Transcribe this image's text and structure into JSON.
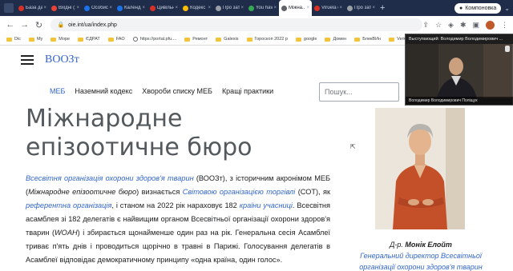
{
  "tabs": [
    {
      "label": "Базa даних ...",
      "color": "#d93025"
    },
    {
      "label": "Вхідні (1) – ...",
      "color": "#ea4335"
    },
    {
      "label": "Особиста ...",
      "color": "#1a73e8"
    },
    {
      "label": "Календар Go...",
      "color": "#1a73e8"
    },
    {
      "label": "Цивільний ...",
      "color": "#d93025"
    },
    {
      "label": "Кодекс атлан...",
      "color": "#fbbc04"
    },
    {
      "label": "Про затвер...",
      "color": "#9aa0a6"
    },
    {
      "label": "You have leg...",
      "color": "#34a853"
    },
    {
      "label": "Міжна...",
      "color": "#5f6368",
      "active": true
    },
    {
      "label": "Viruela ovin...",
      "color": "#d93025"
    },
    {
      "label": "Про затвер...",
      "color": "#9aa0a6"
    }
  ],
  "new_tab": "+",
  "profile_button": "Компоновка",
  "url": "oie.int/ua/index.php",
  "bookmarks": [
    "Dic",
    "My",
    "Море",
    "ЄДРАТ",
    "FAO",
    "https://portal.pfu....",
    "Ремонт",
    "Galexis",
    "Гороскоп 2022 р",
    "google",
    "Домен",
    "БлекВИн",
    "VerkPanel"
  ],
  "site": {
    "wordmark": "ВООЗт",
    "nav": [
      "МЕБ",
      "Наземний кодекс",
      "Хвороби списку МЕБ",
      "Кращі практики"
    ],
    "search_placeholder": "Пошук...",
    "title": "Міжнародне епізоотичне бюро",
    "caption_prefix": "Д-р. ",
    "caption_name": "Монік Елойт",
    "caption_role": "Генеральний директор Всесвітньої організації охорони здоров'я тварин"
  },
  "body": {
    "p1": "Всесвітня організація охорони здоров'я тварин",
    "p2": " (ВООЗт), з історичним акронімом МЕБ (",
    "p3": "Міжнародне епізоотичне бюро",
    "p4": ") визнається ",
    "p5": "Світовою організацією торгівлі",
    "p6": " (СОТ), як ",
    "p7": "референтна організація",
    "p8": ", і станом на 2022 рік нараховує 182 ",
    "p9": "країни учасниці",
    "p10": ". Всесвітня асамблея зі 182 делегатів є найвищим органом Всесвітньої організації охорони здоров'я тварин (",
    "p11": "WOAH",
    "p12": ") і збирається щонайменше один раз на рік. Генеральна сесія Асамблеї триває п'ять днів і проводиться щорічно в травні в Парижі. Голосування делегатів в Асамблеї відповідає демократичному принципу «одна країна, один голос»."
  },
  "video": {
    "top_label": "Выступающий: Володимир Володимирович ...",
    "bottom_label": "Володимир Володимирович Поліщук"
  }
}
